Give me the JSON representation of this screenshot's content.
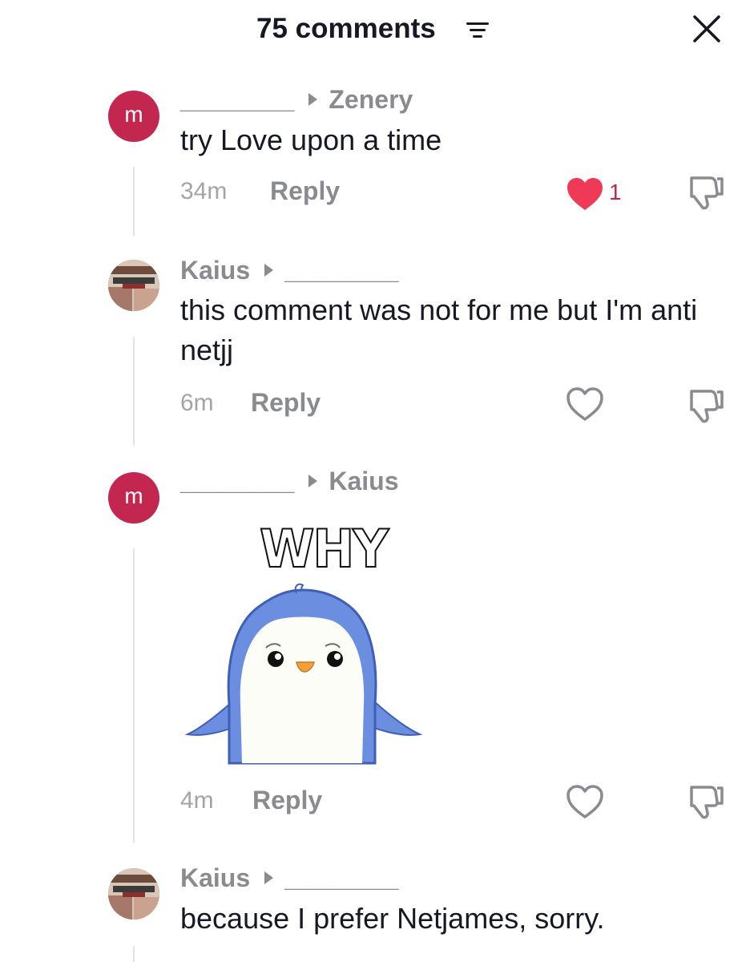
{
  "header": {
    "title": "75 comments"
  },
  "icons": {
    "filter": "filter-lines-icon",
    "close": "close-x-icon",
    "like": "heart-icon",
    "dislike": "thumbs-down-icon"
  },
  "colors": {
    "accent": "#c3264e",
    "muted": "#8a8b91",
    "text": "#161823"
  },
  "comments": [
    {
      "avatar_letter": "m",
      "author": "________",
      "reply_to": "Zenery",
      "text": "try Love upon a time",
      "time": "34m",
      "reply_label": "Reply",
      "liked": true,
      "like_count": "1"
    },
    {
      "avatar_letter": "",
      "author": "Kaius",
      "reply_to": "________",
      "text": "this comment was not for me but I'm anti netjj",
      "time": "6m",
      "reply_label": "Reply",
      "liked": false
    },
    {
      "avatar_letter": "m",
      "author": "________",
      "reply_to": "Kaius",
      "sticker_text": "WHY",
      "time": "4m",
      "reply_label": "Reply",
      "liked": false
    },
    {
      "avatar_letter": "",
      "author": "Kaius",
      "reply_to": "________",
      "text": "because I prefer Netjames, sorry."
    }
  ]
}
